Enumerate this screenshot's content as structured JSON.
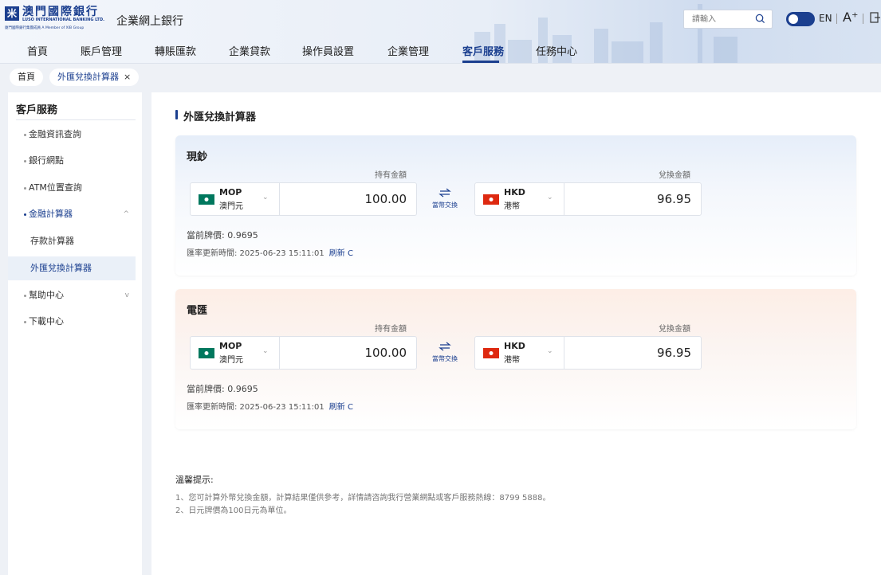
{
  "brand": {
    "logo_mark": "米",
    "name_cn": "澳門國際銀行",
    "name_en": "LUSO INTERNATIONAL BANKING LTD.",
    "member": "廈門國際銀行集團成員 A Member of XIB Group",
    "app_title": "企業網上銀行"
  },
  "header": {
    "search_placeholder": "請輸入",
    "lang": "EN",
    "font_size_label": "A⁺"
  },
  "nav": {
    "items": [
      "首頁",
      "賬戶管理",
      "轉賬匯款",
      "企業貸款",
      "操作員設置",
      "企業管理",
      "客戶服務",
      "任務中心"
    ],
    "active_index": 6
  },
  "tabs": [
    {
      "label": "首頁"
    },
    {
      "label": "外匯兌換計算器",
      "close": "×"
    }
  ],
  "sidebar": {
    "title": "客戶服務",
    "items": [
      {
        "label": "金融資訊查詢"
      },
      {
        "label": "銀行網點"
      },
      {
        "label": "ATM位置查詢"
      },
      {
        "label": "金融計算器",
        "chevron": "^"
      },
      {
        "label": "幫助中心",
        "chevron": "v"
      },
      {
        "label": "下載中心"
      }
    ],
    "sub_items": [
      {
        "label": "存款計算器"
      },
      {
        "label": "外匯兌換計算器"
      }
    ]
  },
  "page": {
    "title": "外匯兌換計算器"
  },
  "cash": {
    "title": "現鈔",
    "hold_label": "持有金額",
    "conv_label": "兌換金額",
    "from_code": "MOP",
    "from_name": "澳門元",
    "from_amount": "100.00",
    "to_code": "HKD",
    "to_name": "港幣",
    "to_amount": "96.95",
    "swap_label": "當幣交換",
    "rate": "當前牌價:  0.9695",
    "update": "匯率更新時間:  2025-06-23 15:11:01",
    "refresh": "刷新 C"
  },
  "wire": {
    "title": "電匯",
    "hold_label": "持有金額",
    "conv_label": "兌換金額",
    "from_code": "MOP",
    "from_name": "澳門元",
    "from_amount": "100.00",
    "to_code": "HKD",
    "to_name": "港幣",
    "to_amount": "96.95",
    "swap_label": "當幣交換",
    "rate": "當前牌價:  0.9695",
    "update": "匯率更新時間:  2025-06-23 15:11:01",
    "refresh": "刷新 C"
  },
  "tips": {
    "title": "溫馨提示:",
    "lines": [
      "1、您可計算外幣兌換金額，計算結果僅供參考，詳情請咨詢我行營業網點或客戶服務熱線：8799 5888。",
      "2、日元牌價為100日元為單位。"
    ]
  },
  "colors": {
    "brand_blue": "#1b3f8f",
    "macau_green": "#00785e",
    "hk_red": "#de2910"
  }
}
